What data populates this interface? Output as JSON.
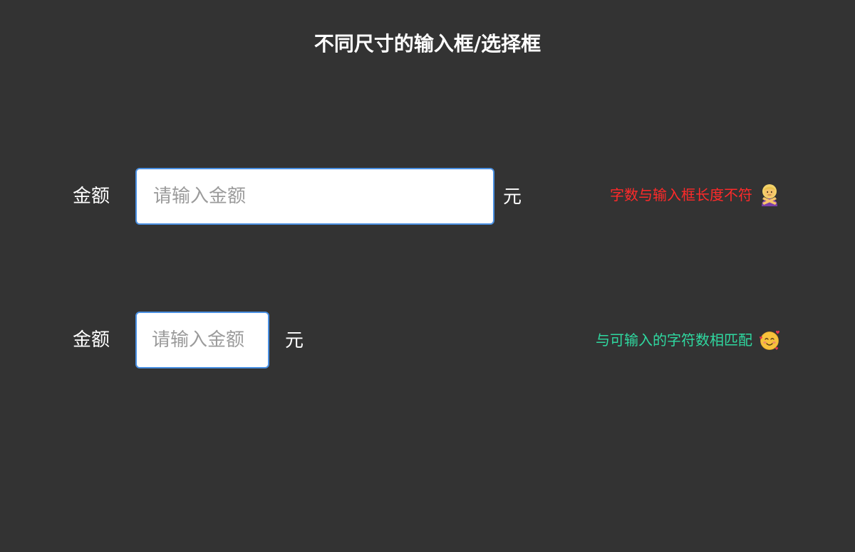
{
  "page": {
    "title": "不同尺寸的输入框/选择框"
  },
  "rows": [
    {
      "label": "金额",
      "placeholder": "请输入金额",
      "unit": "元",
      "note": "字数与输入框长度不符",
      "note_icon": "person-gesturing-no-icon",
      "note_color": "#ff2a2a"
    },
    {
      "label": "金额",
      "placeholder": "请输入金额",
      "unit": "元",
      "note": "与可输入的字符数相匹配",
      "note_icon": "smiling-face-with-hearts-icon",
      "note_color": "#2fd9a0"
    }
  ],
  "colors": {
    "background": "#333333",
    "input_border": "#4a90e2",
    "placeholder": "#9b9b9b"
  }
}
